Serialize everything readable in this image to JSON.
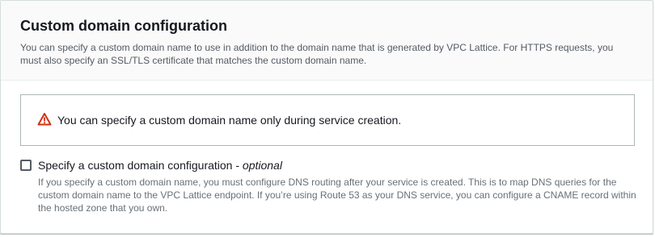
{
  "panel": {
    "title": "Custom domain configuration",
    "description": "You can specify a custom domain name to use in addition to the domain name that is generated by VPC Lattice. For HTTPS requests, you must also specify an SSL/TLS certificate that matches the custom domain name."
  },
  "alert": {
    "icon": "warning-icon",
    "text": "You can specify a custom domain name only during service creation."
  },
  "custom_domain_option": {
    "label": "Specify a custom domain configuration - ",
    "optional_label": "optional",
    "checked": false,
    "description": "If you specify a custom domain name, you must configure DNS routing after your service is created. This is to map DNS queries for the custom domain name to the VPC Lattice endpoint. If you’re using Route 53 as your DNS service, you can configure a CNAME record within the hosted zone that you own."
  },
  "colors": {
    "warning": "#d13212",
    "border": "#aab7b8",
    "header_bg": "#fafafa",
    "text_secondary": "#545b64"
  }
}
